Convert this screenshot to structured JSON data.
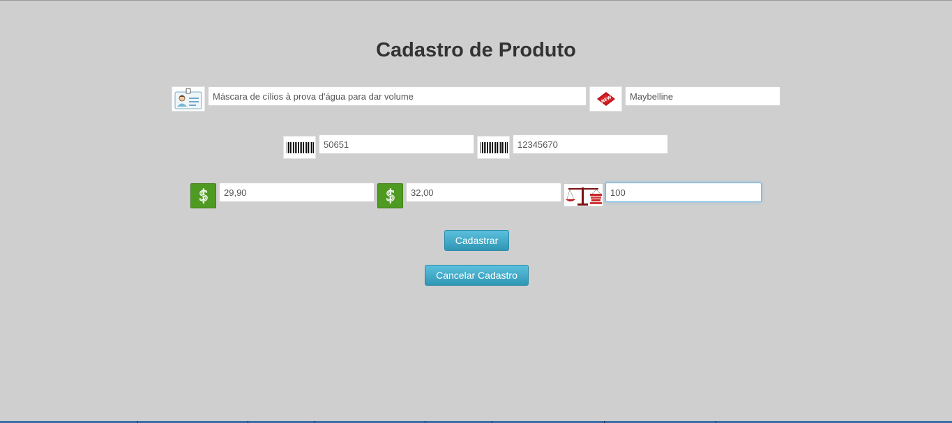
{
  "page": {
    "title": "Cadastro de Produto"
  },
  "form": {
    "description": {
      "icon": "id-card-icon",
      "value": "Máscara de cílios à prova d'água para dar volume"
    },
    "brand": {
      "icon": "brand-tag-icon",
      "value": "Maybelline"
    },
    "code": {
      "icon": "barcode-icon",
      "value": "50651"
    },
    "barcode": {
      "icon": "barcode-icon",
      "value": "12345670"
    },
    "cost_price": {
      "icon": "dollar-icon",
      "value": "29,90"
    },
    "sale_price": {
      "icon": "dollar-icon",
      "value": "32,00"
    },
    "quantity": {
      "icon": "scale-icon",
      "value": "100"
    }
  },
  "actions": {
    "submit_label": "Cadastrar",
    "cancel_label": "Cancelar Cadastro"
  },
  "colors": {
    "background": "#cfcfcf",
    "button": "#49afcd",
    "dollar_icon": "#4f9a22",
    "brand_tag": "#c0141b"
  }
}
